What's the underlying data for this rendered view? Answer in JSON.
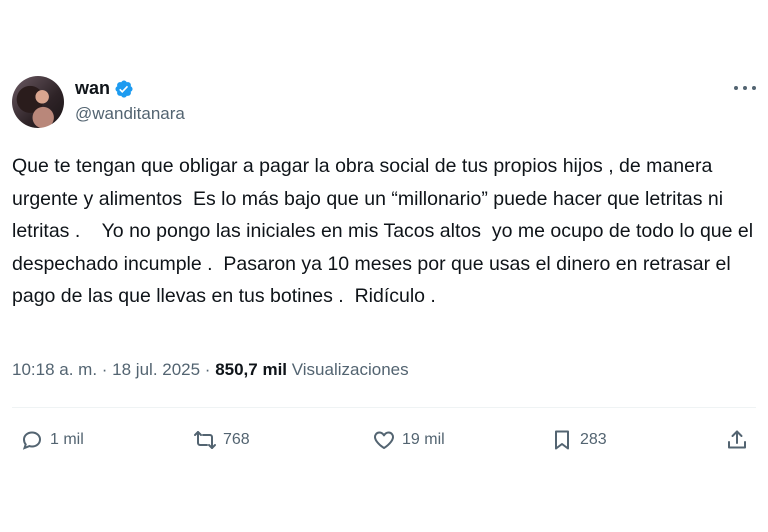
{
  "author": {
    "name": "wan",
    "handle": "@wanditanara"
  },
  "tweet": {
    "text": "Que te tengan que obligar a pagar la obra social de tus propios hijos , de manera urgente y alimentos  Es lo más bajo que un “millonario” puede hacer que letritas ni letritas .    Yo no pongo las iniciales en mis Tacos altos  yo me ocupo de todo lo que el despechado incumple .  Pasaron ya 10 meses por que usas el dinero en retrasar el pago de las que llevas en tus botines .  Ridículo .",
    "time": "10:18 a. m.",
    "separator": " · ",
    "date": "18 jul. 2025",
    "views_count": "850,7 mil",
    "views_label": "Visualizaciones"
  },
  "actions": {
    "replies": "1 mil",
    "reposts": "768",
    "likes": "19 mil",
    "bookmarks": "283"
  },
  "colors": {
    "verified": "#1d9bf0",
    "text": "#0f1419",
    "secondary": "#536471"
  },
  "icons": [
    "verified-badge-icon",
    "more-icon",
    "reply-icon",
    "repost-icon",
    "like-icon",
    "bookmark-icon",
    "share-icon"
  ]
}
